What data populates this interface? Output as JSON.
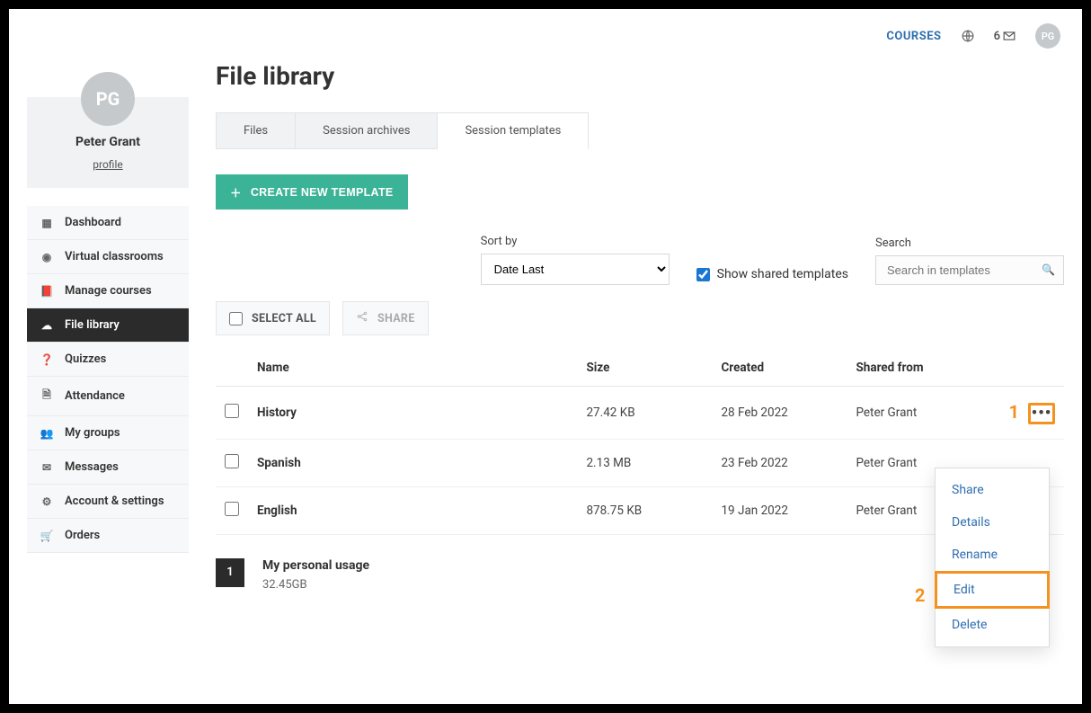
{
  "topbar": {
    "courses_label": "COURSES",
    "mail_count": "6",
    "avatar_initials": "PG"
  },
  "profile": {
    "initials": "PG",
    "name": "Peter Grant",
    "profile_link": "profile"
  },
  "nav": {
    "items": [
      {
        "label": "Dashboard",
        "icon": "grid"
      },
      {
        "label": "Virtual classrooms",
        "icon": "play"
      },
      {
        "label": "Manage courses",
        "icon": "book"
      },
      {
        "label": "File library",
        "icon": "cloud"
      },
      {
        "label": "Quizzes",
        "icon": "help"
      },
      {
        "label": "Attendance",
        "icon": "doc"
      },
      {
        "label": "My groups",
        "icon": "users"
      },
      {
        "label": "Messages",
        "icon": "mail"
      },
      {
        "label": "Account & settings",
        "icon": "gear"
      },
      {
        "label": "Orders",
        "icon": "cart"
      }
    ],
    "active_index": 3
  },
  "page": {
    "title": "File library"
  },
  "tabs": {
    "items": [
      "Files",
      "Session archives",
      "Session templates"
    ],
    "active_index": 2
  },
  "create_btn": "CREATE NEW TEMPLATE",
  "sort": {
    "label": "Sort by",
    "selected": "Date Last"
  },
  "shared_toggle": {
    "label": "Show shared templates",
    "checked": true
  },
  "search": {
    "label": "Search",
    "placeholder": "Search in templates"
  },
  "bulk": {
    "select_all": "SELECT ALL",
    "share": "SHARE"
  },
  "table": {
    "headers": [
      "Name",
      "Size",
      "Created",
      "Shared from"
    ],
    "rows": [
      {
        "name": "History",
        "size": "27.42 KB",
        "created": "28 Feb 2022",
        "shared_from": "Peter Grant"
      },
      {
        "name": "Spanish",
        "size": "2.13 MB",
        "created": "23 Feb 2022",
        "shared_from": "Peter Grant"
      },
      {
        "name": "English",
        "size": "878.75 KB",
        "created": "19 Jan 2022",
        "shared_from": "Peter Grant"
      }
    ]
  },
  "row_menu": {
    "items": [
      "Share",
      "Details",
      "Rename",
      "Edit",
      "Delete"
    ]
  },
  "callouts": {
    "one": "1",
    "two": "2"
  },
  "pagination": {
    "current": "1"
  },
  "usage": {
    "title": "My personal usage",
    "value": "32.45GB"
  }
}
